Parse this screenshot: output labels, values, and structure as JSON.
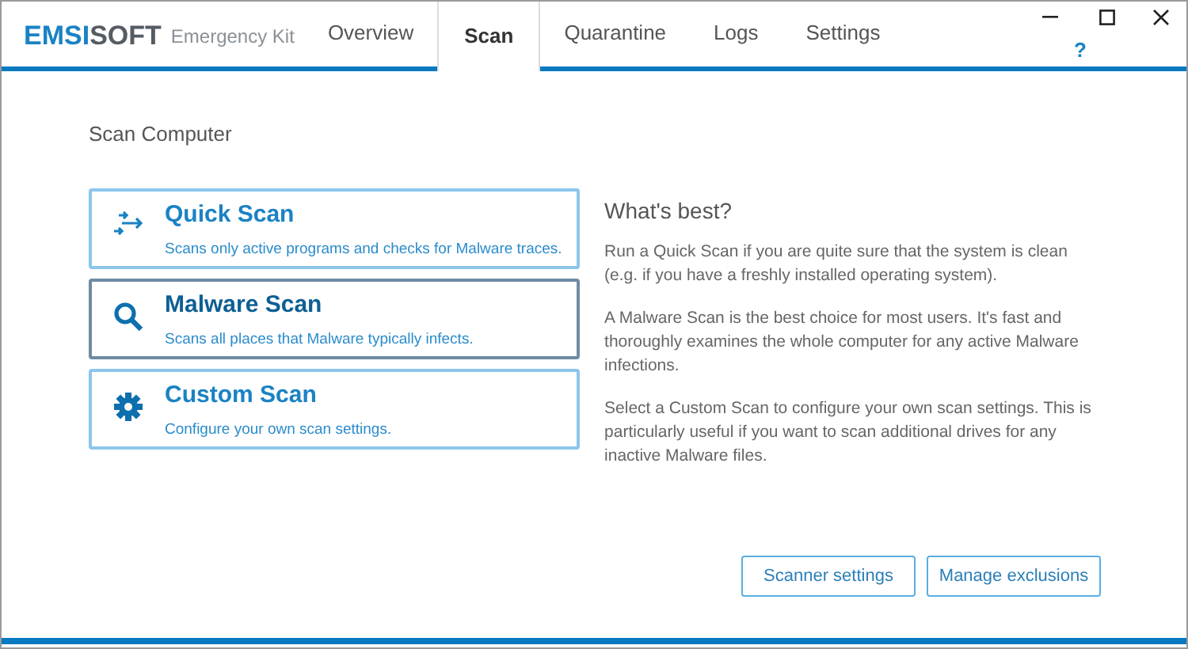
{
  "logo": {
    "brand_first": "EMSI",
    "brand_second": "SOFT",
    "product": "Emergency Kit"
  },
  "tabs": [
    {
      "label": "Overview",
      "selected": false
    },
    {
      "label": "Scan",
      "selected": true
    },
    {
      "label": "Quarantine",
      "selected": false
    },
    {
      "label": "Logs",
      "selected": false
    },
    {
      "label": "Settings",
      "selected": false
    }
  ],
  "help": "?",
  "section_title": "Scan Computer",
  "scan_options": [
    {
      "kind": "quick",
      "title": "Quick Scan",
      "description": "Scans only active programs and checks for Malware traces.",
      "selected": false
    },
    {
      "kind": "malware",
      "title": "Malware Scan",
      "description": "Scans all places that Malware typically infects.",
      "selected": true
    },
    {
      "kind": "custom",
      "title": "Custom Scan",
      "description": "Configure your own scan settings.",
      "selected": false
    }
  ],
  "info": {
    "title": "What's best?",
    "paragraphs": [
      "Run a Quick Scan if you are quite sure that the system is clean (e.g. if you have a freshly installed operating system).",
      "A Malware Scan is the best choice for most users. It's fast and thoroughly examines the whole computer for any active Malware infections.",
      "Select a Custom Scan to configure your own scan settings. This is particularly useful if you want to scan additional drives for any inactive Malware files."
    ]
  },
  "buttons": [
    "Scanner settings",
    "Manage exclusions"
  ]
}
